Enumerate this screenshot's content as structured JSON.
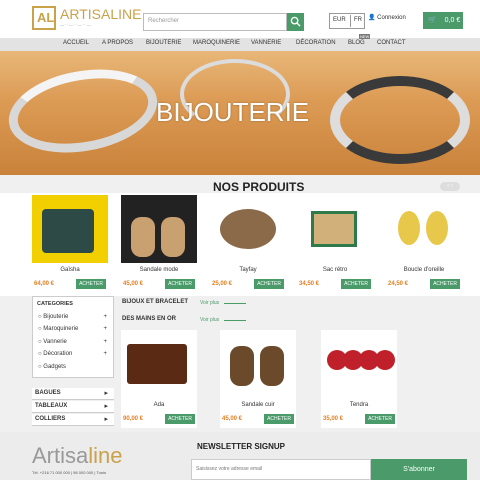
{
  "header": {
    "logo_name": "ARTISALINE",
    "logo_mark": "AL",
    "search_placeholder": "Rechercher",
    "lang_eur": "EUR",
    "lang_fr": "FR",
    "account": "Connexion",
    "cart": "0,0 €"
  },
  "nav": {
    "items": [
      "Accueil",
      "A propos",
      "Bijouterie",
      "Maroquinerie",
      "Vannerie",
      "Décoration",
      "Blog",
      "Contact"
    ],
    "blog_badge": "NEW"
  },
  "banner": {
    "title": "BIJOUTERIE"
  },
  "products_section": {
    "title": "NOS PRODUITS"
  },
  "products": [
    {
      "name": "Gaïsha",
      "price": "64,00 €",
      "buy": "ACHETER"
    },
    {
      "name": "Sandale mode",
      "price": "45,00 €",
      "buy": "ACHETER"
    },
    {
      "name": "Tayfay",
      "price": "25,00 €",
      "buy": "ACHETER"
    },
    {
      "name": "Sac rétro",
      "price": "34,50 €",
      "buy": "ACHETER"
    },
    {
      "name": "Boucle d'oreille",
      "price": "24,50 €",
      "buy": "ACHETER"
    }
  ],
  "sidebar": {
    "categories_title": "CATEGORIES",
    "categories": [
      "Bijouterie",
      "Maroquinerie",
      "Vannerie",
      "Décoration",
      "Gadgets"
    ],
    "rows": [
      "BAGUES",
      "TABLEAUX",
      "COLLIERS"
    ]
  },
  "subsections": [
    {
      "title": "BIJOUX ET BRACELET",
      "voir": "Voir plus"
    },
    {
      "title": "DES MAINS EN OR",
      "voir": "Voir plus"
    }
  ],
  "featured": [
    {
      "name": "Ada",
      "price": "90,00 €",
      "buy": "ACHETER"
    },
    {
      "name": "Sandale cuir",
      "price": "45,00 €",
      "buy": "ACHETER"
    },
    {
      "name": "Tendra",
      "price": "35,00 €",
      "buy": "ACHETER"
    }
  ],
  "footer": {
    "logo_a": "Artisa",
    "logo_b": "line",
    "address": "Tél. +216 71 000 000 | 98 000 000 | Tunis",
    "newsletter_title": "NEWSLETTER SIGNUP",
    "email_placeholder": "Saisissez votre adresse email",
    "subscribe": "S'abonner"
  },
  "colors": {
    "accent": "#4a9a6a",
    "brand": "#c9a24a",
    "price": "#e67e22"
  }
}
